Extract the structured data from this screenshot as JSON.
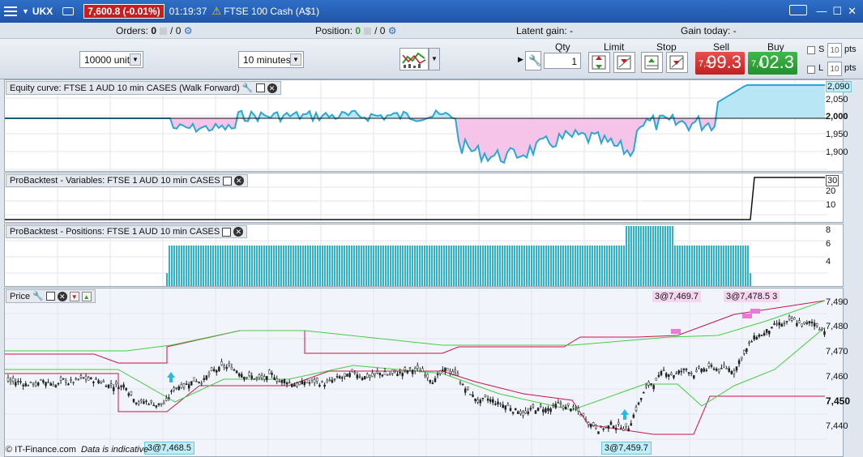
{
  "titlebar": {
    "symbol": "UKX",
    "price_badge": "7,600.8 (-0.01%)",
    "time": "01:19:37",
    "warning_icon": "warning-icon",
    "market": "FTSE 100 Cash (A$1)",
    "window_buttons": [
      "—",
      "☐",
      "✕"
    ]
  },
  "status": {
    "orders_label": "Orders:",
    "orders_value": "0",
    "orders_sep": "/ 0",
    "position_label": "Position:",
    "position_value": "0",
    "position_sep": "/ 0",
    "latent_gain": "Latent gain: -",
    "gain_today": "Gain today: -"
  },
  "toolbar": {
    "units": "10000 units",
    "timeframe": "10 minutes"
  },
  "trade": {
    "qty_label": "Qty",
    "qty_value": "1",
    "limit_label": "Limit",
    "stop_label": "Stop",
    "sell_label": "Sell",
    "buy_label": "Buy",
    "sell_prefix": "7,5",
    "sell_big": "99.3",
    "buy_prefix": "7,6",
    "buy_big": "02.3",
    "s_label": "S",
    "l_label": "L",
    "s_pts": "10",
    "l_pts": "10",
    "pts": "pts"
  },
  "panels": {
    "equity": {
      "title": "Equity curve: FTSE 1 AUD 10 min CASES (Walk Forward)",
      "ticks": [
        "2,090",
        "2,050",
        "2,000",
        "1,950",
        "1,900"
      ]
    },
    "variables": {
      "title": "ProBacktest - Variables: FTSE 1 AUD 10 min CASES",
      "ticks": [
        "30",
        "20",
        "10"
      ]
    },
    "positions": {
      "title": "ProBacktest - Positions: FTSE 1 AUD 10 min CASES",
      "ticks": [
        "8",
        "6",
        "4"
      ]
    },
    "price": {
      "title": "Price",
      "ticks": [
        "7,490",
        "7,480",
        "7,470",
        "7,460",
        "7,450",
        "7,440"
      ],
      "tag1": "3@7,469.7",
      "tag2": "3@7,478.5",
      "tag2b": "3",
      "tag_buy1": "3@7,468.5",
      "tag_buy2": "3@7,459.7"
    }
  },
  "footer": {
    "copyright": "© IT-Finance.com",
    "note": "Data is indicative"
  },
  "colors": {
    "sell": "#d23232",
    "buy": "#2ea23a",
    "equity_pos": "#b8e6f5",
    "equity_neg": "#f5c4e8",
    "band_upper": "#c8144a",
    "band_lower": "#44cc44",
    "position_bar": "#29b5cc"
  }
}
